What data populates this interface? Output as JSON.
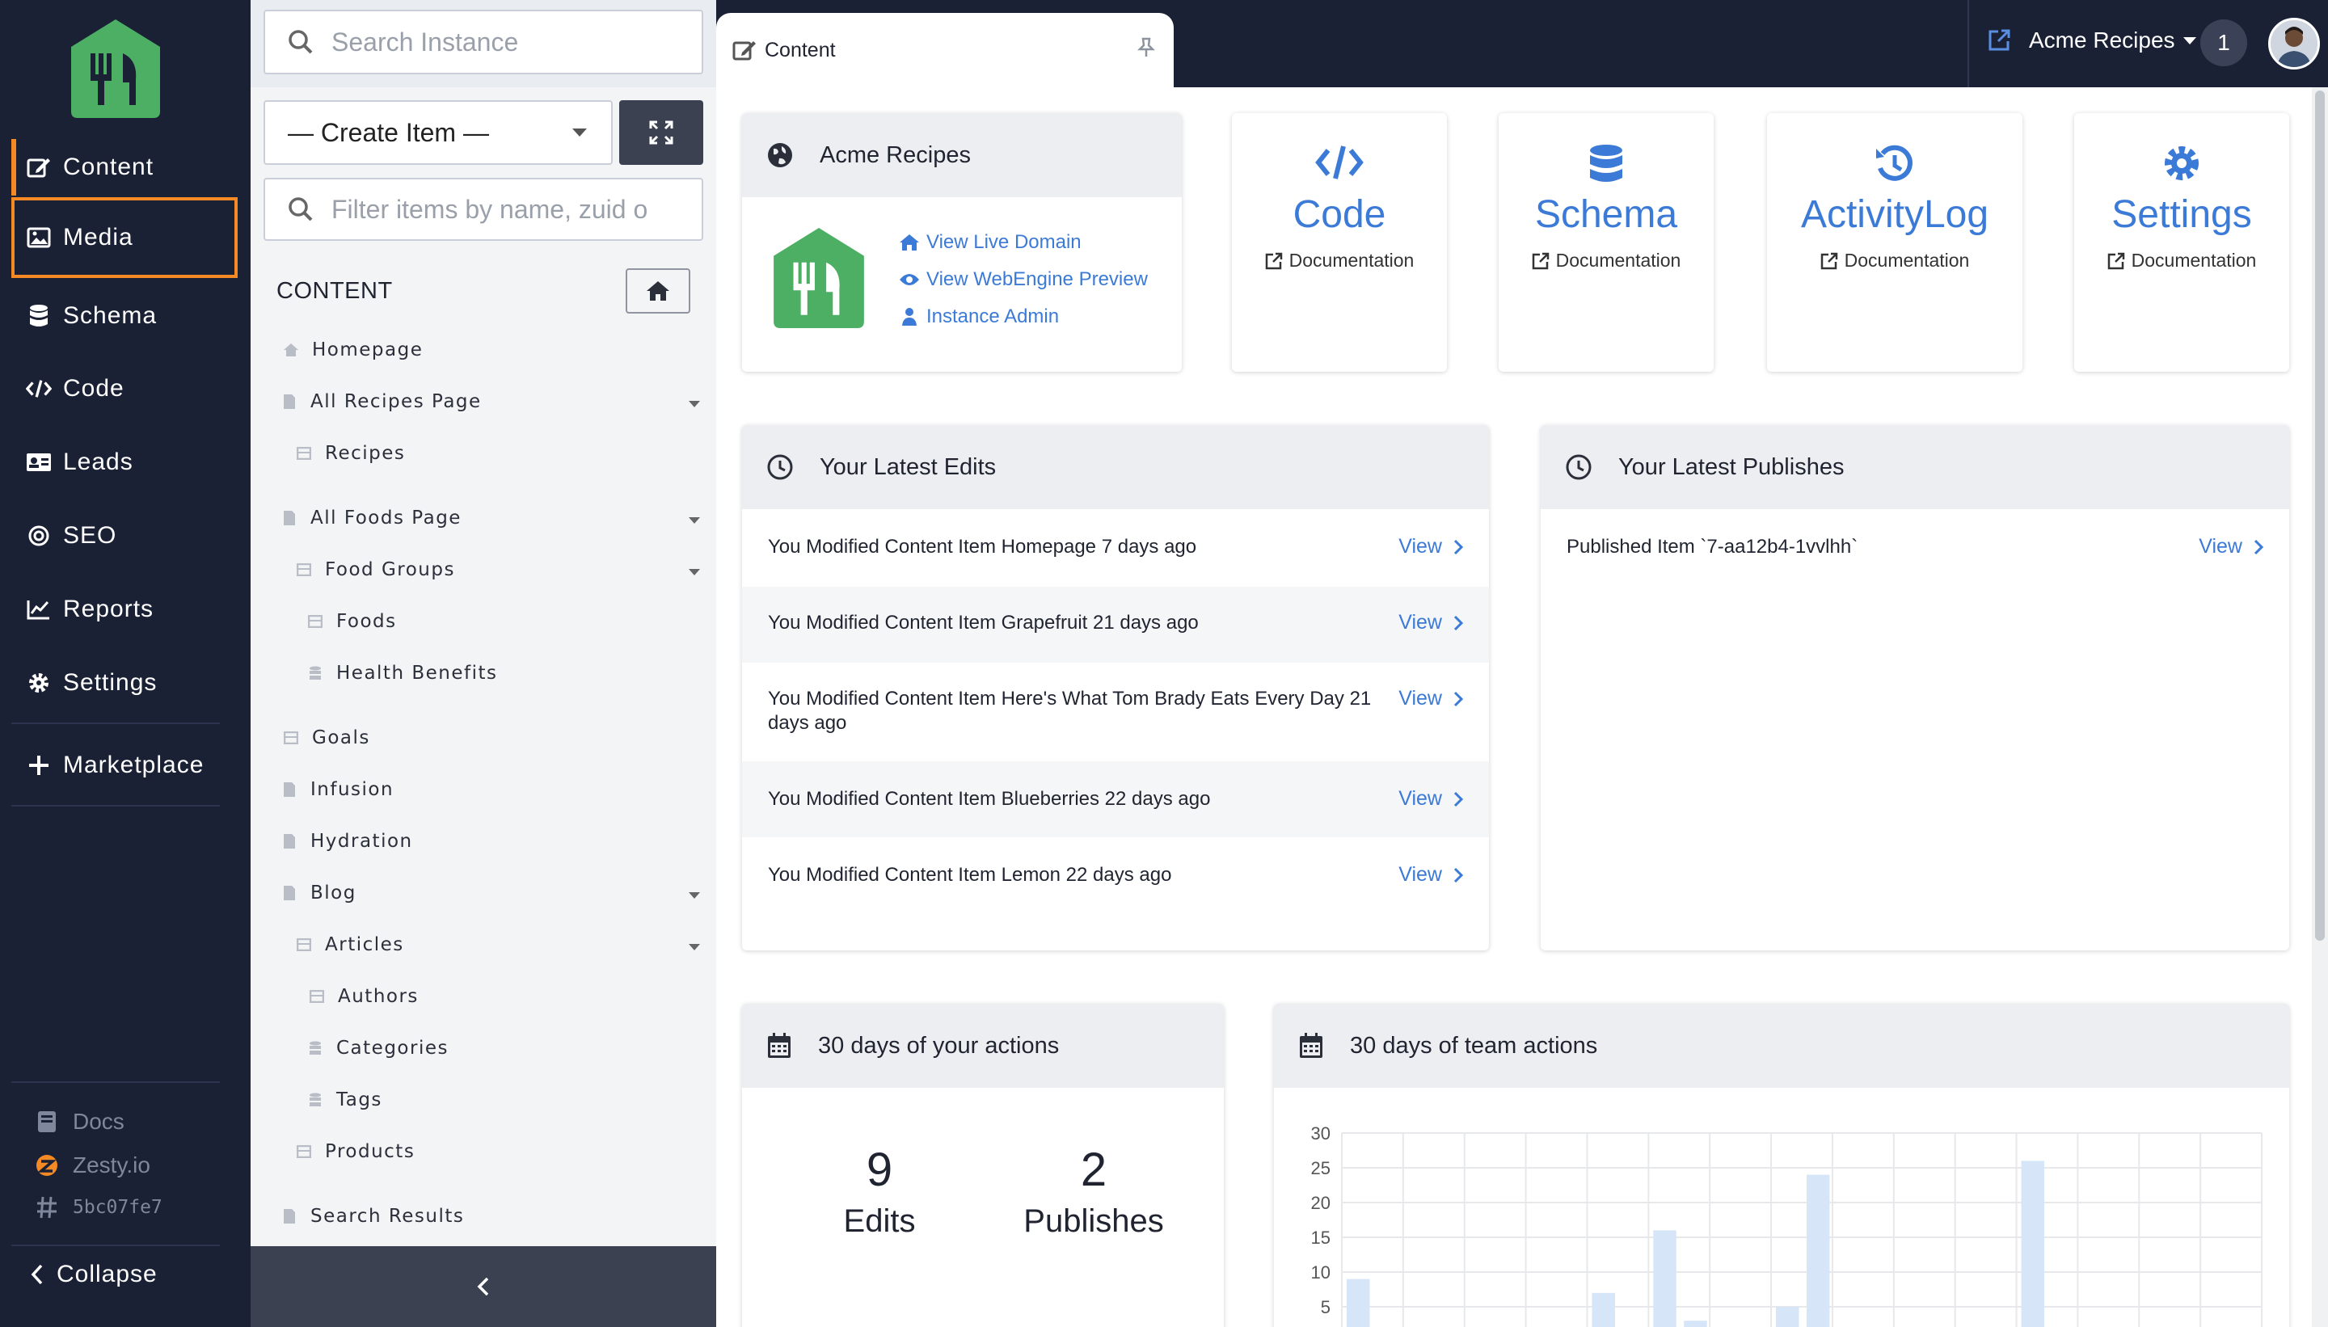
{
  "colors": {
    "nav_bg": "#1b2135",
    "accent": "#f58a24",
    "link": "#3b7ad6",
    "brand_green": "#4caf63"
  },
  "leftnav": {
    "items": [
      {
        "label": "Content",
        "icon": "edit-icon"
      },
      {
        "label": "Media",
        "icon": "image-icon"
      },
      {
        "label": "Schema",
        "icon": "database-icon"
      },
      {
        "label": "Code",
        "icon": "code-icon"
      },
      {
        "label": "Leads",
        "icon": "id-card-icon"
      },
      {
        "label": "SEO",
        "icon": "target-icon"
      },
      {
        "label": "Reports",
        "icon": "chart-line-icon"
      },
      {
        "label": "Settings",
        "icon": "gear-icon"
      }
    ],
    "marketplace": "Marketplace",
    "footer": {
      "docs": "Docs",
      "zesty": "Zesty.io",
      "hash": "5bc07fe7"
    },
    "collapse": "Collapse"
  },
  "tree_panel": {
    "search_placeholder": "Search Instance",
    "create_label": "— Create Item —",
    "filter_placeholder": "Filter items by name, zuid o",
    "heading": "CONTENT",
    "items": [
      {
        "label": "Homepage",
        "icon": "home-icon"
      },
      {
        "label": "All Recipes Page",
        "icon": "file-icon"
      },
      {
        "label": "Recipes",
        "icon": "list-icon"
      },
      {
        "label": "All Foods Page",
        "icon": "file-icon"
      },
      {
        "label": "Food Groups",
        "icon": "list-icon"
      },
      {
        "label": "Foods",
        "icon": "list-icon"
      },
      {
        "label": "Health Benefits",
        "icon": "db-icon"
      },
      {
        "label": "Goals",
        "icon": "list-icon"
      },
      {
        "label": "Infusion",
        "icon": "file-icon"
      },
      {
        "label": "Hydration",
        "icon": "file-icon"
      },
      {
        "label": "Blog",
        "icon": "file-icon"
      },
      {
        "label": "Articles",
        "icon": "list-icon"
      },
      {
        "label": "Authors",
        "icon": "list-icon"
      },
      {
        "label": "Categories",
        "icon": "db-icon"
      },
      {
        "label": "Tags",
        "icon": "db-icon"
      },
      {
        "label": "Products",
        "icon": "list-icon"
      },
      {
        "label": "Search Results",
        "icon": "file-icon"
      }
    ]
  },
  "topbar": {
    "tab_label": "Content",
    "instance_name": "Acme Recipes",
    "notification_count": "1"
  },
  "instance_card": {
    "title": "Acme Recipes",
    "links": [
      "View Live Domain",
      "View WebEngine Preview",
      "Instance Admin"
    ]
  },
  "tools": [
    {
      "title": "Code",
      "doc": "Documentation",
      "icon": "code-icon"
    },
    {
      "title": "Schema",
      "doc": "Documentation",
      "icon": "database-icon"
    },
    {
      "title": "ActivityLog",
      "doc": "Documentation",
      "icon": "history-icon"
    },
    {
      "title": "Settings",
      "doc": "Documentation",
      "icon": "gear-icon"
    }
  ],
  "latest_edits": {
    "title": "Your Latest Edits",
    "view_label": "View",
    "rows": [
      "You Modified Content Item Homepage 7 days ago",
      "You Modified Content Item Grapefruit 21 days ago",
      "You Modified Content Item Here's What Tom Brady Eats Every Day 21 days ago",
      "You Modified Content Item Blueberries 22 days ago",
      "You Modified Content Item Lemon 22 days ago"
    ]
  },
  "latest_publishes": {
    "title": "Your Latest Publishes",
    "view_label": "View",
    "rows": [
      "Published Item `7-aa12b4-1vvlhh`"
    ]
  },
  "your_actions": {
    "title": "30 days of your actions",
    "stats": [
      {
        "value": "9",
        "label": "Edits"
      },
      {
        "value": "2",
        "label": "Publishes"
      }
    ]
  },
  "team_actions": {
    "title": "30 days of team actions"
  },
  "chart_data": {
    "type": "bar",
    "title": "30 days of team actions",
    "yticks": [
      "30",
      "25",
      "20",
      "15",
      "10",
      "5"
    ],
    "ylim": [
      0,
      30
    ],
    "grid": true,
    "days": 30,
    "values": [
      9,
      0,
      0,
      0,
      0,
      0,
      0,
      0,
      7,
      0,
      16,
      3,
      0,
      0,
      5,
      24,
      0,
      0,
      0,
      0,
      0,
      0,
      26,
      0,
      0,
      0,
      0,
      0,
      0,
      0
    ]
  }
}
